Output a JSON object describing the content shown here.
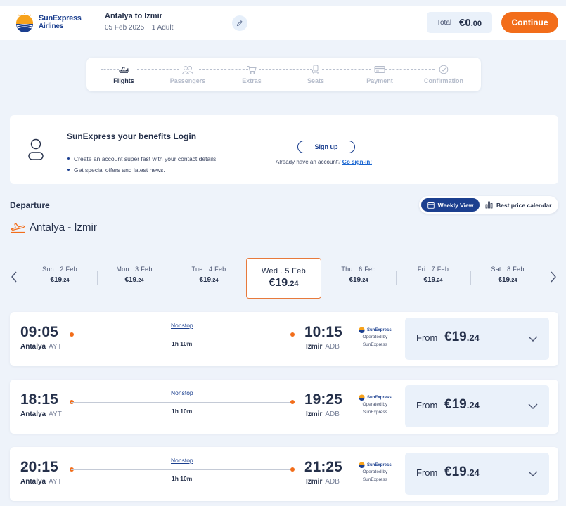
{
  "header": {
    "logo_line1": "SunExpress",
    "logo_line2": "Airlines",
    "route": "Antalya to Izmir",
    "date": "05 Feb 2025",
    "passengers": "1 Adult",
    "total_label": "Total",
    "total_amount": "€0",
    "total_decimals": ".00",
    "continue_label": "Continue"
  },
  "steps": [
    {
      "label": "Flights",
      "icon": "plane-icon",
      "active": true
    },
    {
      "label": "Passengers",
      "icon": "passengers-icon",
      "active": false
    },
    {
      "label": "Extras",
      "icon": "cart-icon",
      "active": false
    },
    {
      "label": "Seats",
      "icon": "seat-icon",
      "active": false
    },
    {
      "label": "Payment",
      "icon": "card-icon",
      "active": false
    },
    {
      "label": "Confirmation",
      "icon": "check-circle-icon",
      "active": false
    }
  ],
  "login": {
    "title": "SunExpress your benefits Login",
    "benefits": [
      "Create an account super fast with your contact details.",
      "Get special offers and latest news."
    ],
    "signup_label": "Sign up",
    "signin_prompt": "Already have an account?",
    "signin_link": "Go sign-in!"
  },
  "departure": {
    "label": "Departure",
    "route": "Antalya - Izmir",
    "weekly_view": "Weekly View",
    "best_price": "Best price calendar"
  },
  "dates": [
    {
      "day": "Sun . 2 Feb",
      "price": "€19",
      "decimals": ".24"
    },
    {
      "day": "Mon . 3 Feb",
      "price": "€19",
      "decimals": ".24"
    },
    {
      "day": "Tue . 4 Feb",
      "price": "€19",
      "decimals": ".24"
    },
    {
      "day": "Wed . 5 Feb",
      "price": "€19",
      "decimals": ".24"
    },
    {
      "day": "Thu . 6 Feb",
      "price": "€19",
      "decimals": ".24"
    },
    {
      "day": "Fri . 7 Feb",
      "price": "€19",
      "decimals": ".24"
    },
    {
      "day": "Sat . 8 Feb",
      "price": "€19",
      "decimals": ".24"
    }
  ],
  "flights": [
    {
      "dep_time": "09:05",
      "arr_time": "10:15",
      "dep_city": "Antalya",
      "dep_code": "AYT",
      "arr_city": "Izmir",
      "arr_code": "ADB",
      "stops": "Nonstop",
      "duration": "1h 10m",
      "price": "€19",
      "decimals": ".24"
    },
    {
      "dep_time": "18:15",
      "arr_time": "19:25",
      "dep_city": "Antalya",
      "dep_code": "AYT",
      "arr_city": "Izmir",
      "arr_code": "ADB",
      "stops": "Nonstop",
      "duration": "1h 10m",
      "price": "€19",
      "decimals": ".24"
    },
    {
      "dep_time": "20:15",
      "arr_time": "21:25",
      "dep_city": "Antalya",
      "dep_code": "AYT",
      "arr_city": "Izmir",
      "arr_code": "ADB",
      "stops": "Nonstop",
      "duration": "1h 10m",
      "price": "€19",
      "decimals": ".24"
    }
  ],
  "flight_common": {
    "operator_brand": "SunExpress",
    "operated_line1": "Operated by",
    "operated_line2": "SunExpress",
    "from_label": "From"
  },
  "colors": {
    "brand_blue": "#1b3f8f",
    "accent_orange": "#f26d1a",
    "background": "#eef3fa"
  }
}
